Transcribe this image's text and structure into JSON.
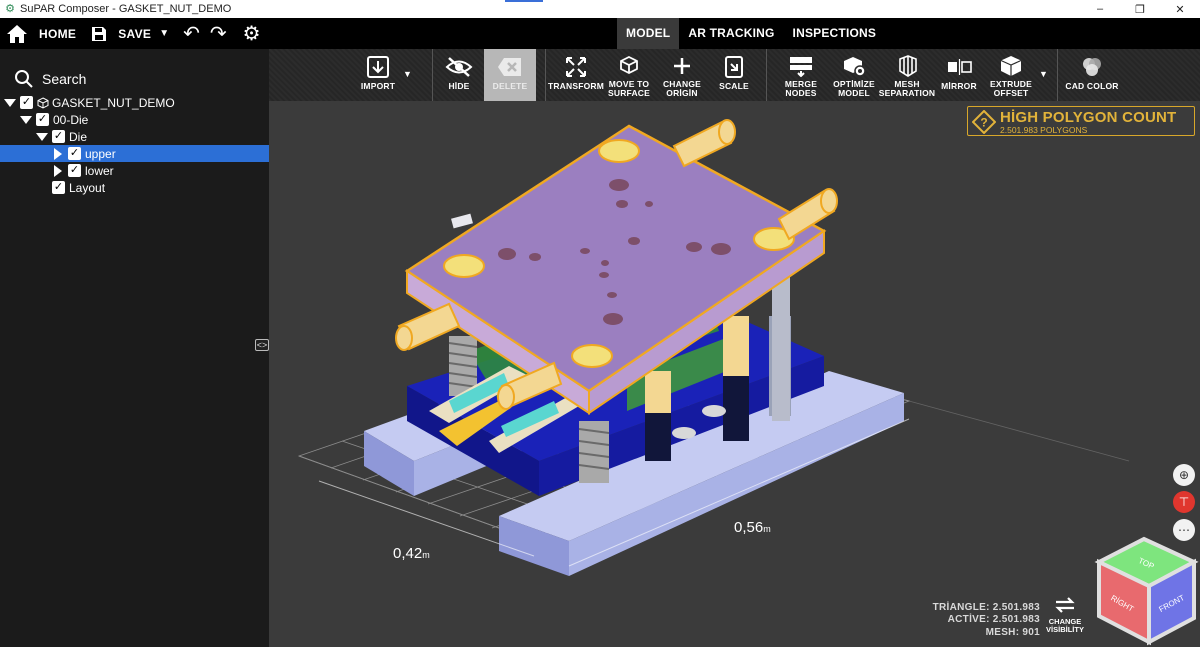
{
  "window": {
    "title": "SuPAR Composer - GASKET_NUT_DEMO",
    "minimize": "–",
    "restore": "❐",
    "close": "✕"
  },
  "topbar": {
    "home_label": "HOME",
    "save_label": "SAVE",
    "tabs": [
      {
        "label": "MODEL",
        "active": true
      },
      {
        "label": "AR TRACKING",
        "active": false
      },
      {
        "label": "INSPECTIONS",
        "active": false
      }
    ]
  },
  "sidebar": {
    "search_placeholder": "Search",
    "tree": [
      {
        "label": "GASKET_NUT_DEMO",
        "level": 0,
        "expanded": true,
        "checked": true,
        "selected": false
      },
      {
        "label": "00-Die",
        "level": 1,
        "expanded": true,
        "checked": true,
        "selected": false
      },
      {
        "label": "Die",
        "level": 2,
        "expanded": true,
        "checked": true,
        "selected": false
      },
      {
        "label": "upper",
        "level": 3,
        "expanded": false,
        "checked": true,
        "selected": true
      },
      {
        "label": "lower",
        "level": 3,
        "expanded": false,
        "checked": true,
        "selected": false
      },
      {
        "label": "Layout",
        "level": 3,
        "expanded": null,
        "checked": true,
        "selected": false
      }
    ]
  },
  "toolbar": {
    "import": "IMPORT",
    "hide": "HİDE",
    "delete": "DELETE",
    "transform": "TRANSFORM",
    "move_to_surface_1": "MOVE TO",
    "move_to_surface_2": "SURFACE",
    "change_origin_1": "CHANGE",
    "change_origin_2": "ORİGİN",
    "scale": "SCALE",
    "merge_nodes_1": "MERGE",
    "merge_nodes_2": "NODES",
    "optimize_model_1": "OPTİMİZE",
    "optimize_model_2": "MODEL",
    "mesh_separation_1": "MESH",
    "mesh_separation_2": "SEPARATION",
    "mirror": "MİRROR",
    "extrude_offset_1": "EXTRUDE",
    "extrude_offset_2": "OFFSET",
    "cad_color": "CAD COLOR"
  },
  "viewport": {
    "warning_title": "HİGH POLYGON COUNT",
    "warning_sub": "2.501.983 POLYGONS",
    "dim_width": "0,56",
    "dim_depth": "0,42",
    "dim_unit": "m",
    "stats": {
      "triangle": "TRİANGLE: 2.501.983",
      "active": "ACTİVE: 2.501.983",
      "mesh": "MESH: 901"
    },
    "change_visibility_1": "CHANGE",
    "change_visibility_2": "VİSİBİLİTY",
    "viewcube": {
      "top": "TOP",
      "right": "RİGHT",
      "front": "FRONT"
    },
    "colors": {
      "top_plate": "#9b7fc0",
      "plate_outline": "#f0a821",
      "guide_pillar": "#f3d792",
      "lower_shoe": "#1b1f9a",
      "base_plate": "#aab4e8",
      "spring": "#a9a9a9"
    }
  }
}
